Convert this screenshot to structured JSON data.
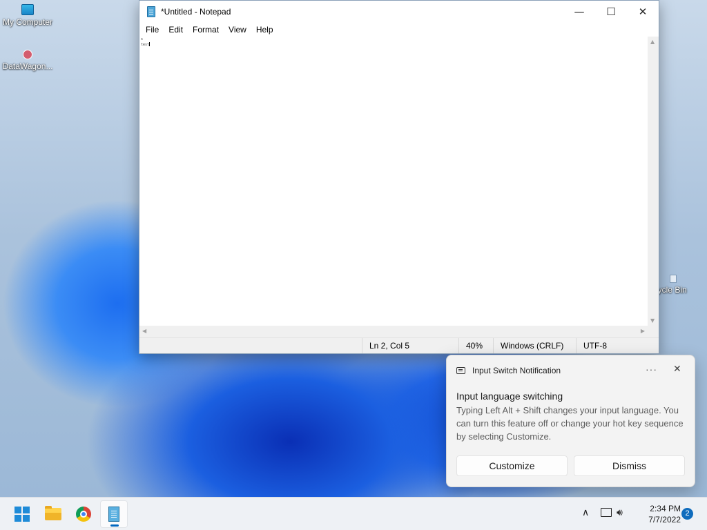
{
  "desktop": {
    "icons": [
      {
        "label": "My Computer"
      },
      {
        "label": "DataWagon..."
      },
      {
        "label": "ecycle Bin"
      }
    ]
  },
  "notepad": {
    "title": "*Untitled - Notepad",
    "controls": {
      "minimize": "—",
      "maximize": "☐",
      "close": "✕"
    },
    "menu": [
      "File",
      "Edit",
      "Format",
      "View",
      "Help"
    ],
    "editor_lines": [
      "s",
      "test"
    ],
    "status": {
      "position": "Ln 2, Col 5",
      "zoom": "40%",
      "line_ending": "Windows (CRLF)",
      "encoding": "UTF-8"
    }
  },
  "toast": {
    "app_name": "Input Switch Notification",
    "more": "···",
    "close": "✕",
    "title": "Input language switching",
    "body": "Typing Left Alt + Shift changes your input language. You can turn this feature off or change your hot key sequence by selecting Customize.",
    "customize_label": "Customize",
    "dismiss_label": "Dismiss"
  },
  "taskbar": {
    "tray": {
      "chevron": "∧",
      "speaker": "🔊︎"
    },
    "clock": {
      "time": "2:34 PM",
      "date": "7/7/2022"
    },
    "notification_count": "2"
  }
}
